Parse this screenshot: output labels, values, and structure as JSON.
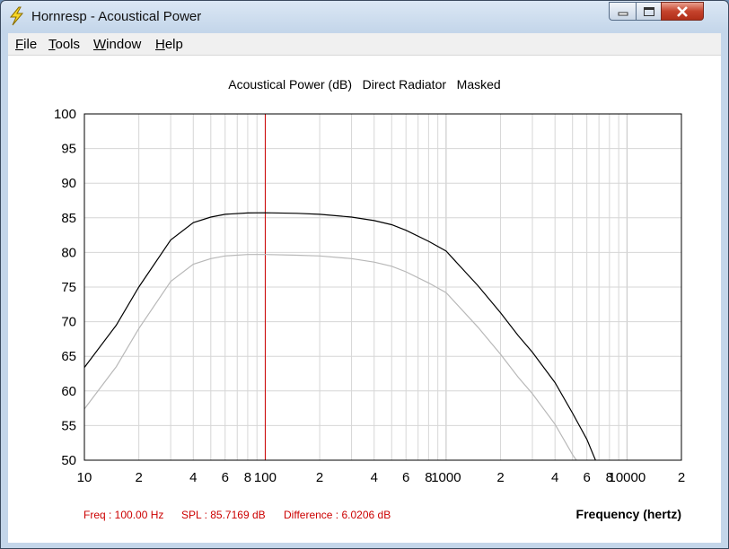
{
  "window": {
    "title": "Hornresp - Acoustical Power"
  },
  "menu": {
    "items": [
      {
        "key": "F",
        "rest": "ile"
      },
      {
        "key": "T",
        "rest": "ools"
      },
      {
        "key": "W",
        "rest": "indow"
      },
      {
        "key": "H",
        "rest": "elp"
      }
    ]
  },
  "status": {
    "freq": "Freq : 100.00 Hz",
    "spl": "SPL : 85.7169 dB",
    "difference": "Difference : 6.0206 dB"
  },
  "colors": {
    "cursor": "#cc0000",
    "status_text": "#cc0000",
    "series1": "#000000",
    "series2": "#b8b8b8",
    "grid": "#d6d6d6"
  },
  "chart_data": {
    "type": "line",
    "title": "Acoustical Power (dB)   Direct Radiator   Masked",
    "xlabel": "Frequency (hertz)",
    "ylabel": "",
    "x_scale": "log",
    "xlim": [
      10,
      20000
    ],
    "ylim": [
      50,
      100
    ],
    "y_ticks": [
      100,
      95,
      90,
      85,
      80,
      75,
      70,
      65,
      60,
      55,
      50
    ],
    "x_tick_labels": [
      {
        "x": 10,
        "label": "10"
      },
      {
        "x": 20,
        "label": "2"
      },
      {
        "x": 40,
        "label": "4"
      },
      {
        "x": 60,
        "label": "6"
      },
      {
        "x": 80,
        "label": "8"
      },
      {
        "x": 100,
        "label": "100"
      },
      {
        "x": 200,
        "label": "2"
      },
      {
        "x": 400,
        "label": "4"
      },
      {
        "x": 600,
        "label": "6"
      },
      {
        "x": 800,
        "label": "8"
      },
      {
        "x": 1000,
        "label": "1000"
      },
      {
        "x": 2000,
        "label": "2"
      },
      {
        "x": 4000,
        "label": "4"
      },
      {
        "x": 6000,
        "label": "6"
      },
      {
        "x": 8000,
        "label": "8"
      },
      {
        "x": 10000,
        "label": "10000"
      },
      {
        "x": 20000,
        "label": "2"
      }
    ],
    "cursor_x": 100,
    "series": [
      {
        "values": [
          [
            10,
            63.4
          ],
          [
            15,
            69.5
          ],
          [
            20,
            75.0
          ],
          [
            30,
            81.8
          ],
          [
            40,
            84.3
          ],
          [
            50,
            85.1
          ],
          [
            60,
            85.5
          ],
          [
            80,
            85.7
          ],
          [
            100,
            85.72
          ],
          [
            150,
            85.65
          ],
          [
            200,
            85.5
          ],
          [
            300,
            85.1
          ],
          [
            400,
            84.6
          ],
          [
            500,
            84.0
          ],
          [
            600,
            83.2
          ],
          [
            800,
            81.6
          ],
          [
            1000,
            80.2
          ],
          [
            1500,
            75.2
          ],
          [
            2000,
            71.3
          ],
          [
            2500,
            68.0
          ],
          [
            3000,
            65.6
          ],
          [
            4000,
            61.2
          ],
          [
            5000,
            56.8
          ],
          [
            6000,
            53.0
          ],
          [
            6700,
            50.0
          ]
        ]
      },
      {
        "values": [
          [
            10,
            57.4
          ],
          [
            15,
            63.5
          ],
          [
            20,
            69.0
          ],
          [
            30,
            75.8
          ],
          [
            40,
            78.3
          ],
          [
            50,
            79.1
          ],
          [
            60,
            79.5
          ],
          [
            80,
            79.7
          ],
          [
            100,
            79.7
          ],
          [
            150,
            79.6
          ],
          [
            200,
            79.5
          ],
          [
            300,
            79.1
          ],
          [
            400,
            78.6
          ],
          [
            500,
            78.0
          ],
          [
            600,
            77.2
          ],
          [
            800,
            75.6
          ],
          [
            1000,
            74.2
          ],
          [
            1500,
            69.2
          ],
          [
            2000,
            65.3
          ],
          [
            2500,
            62.0
          ],
          [
            3000,
            59.6
          ],
          [
            4000,
            55.2
          ],
          [
            5000,
            50.8
          ],
          [
            5250,
            50.0
          ]
        ]
      }
    ]
  }
}
